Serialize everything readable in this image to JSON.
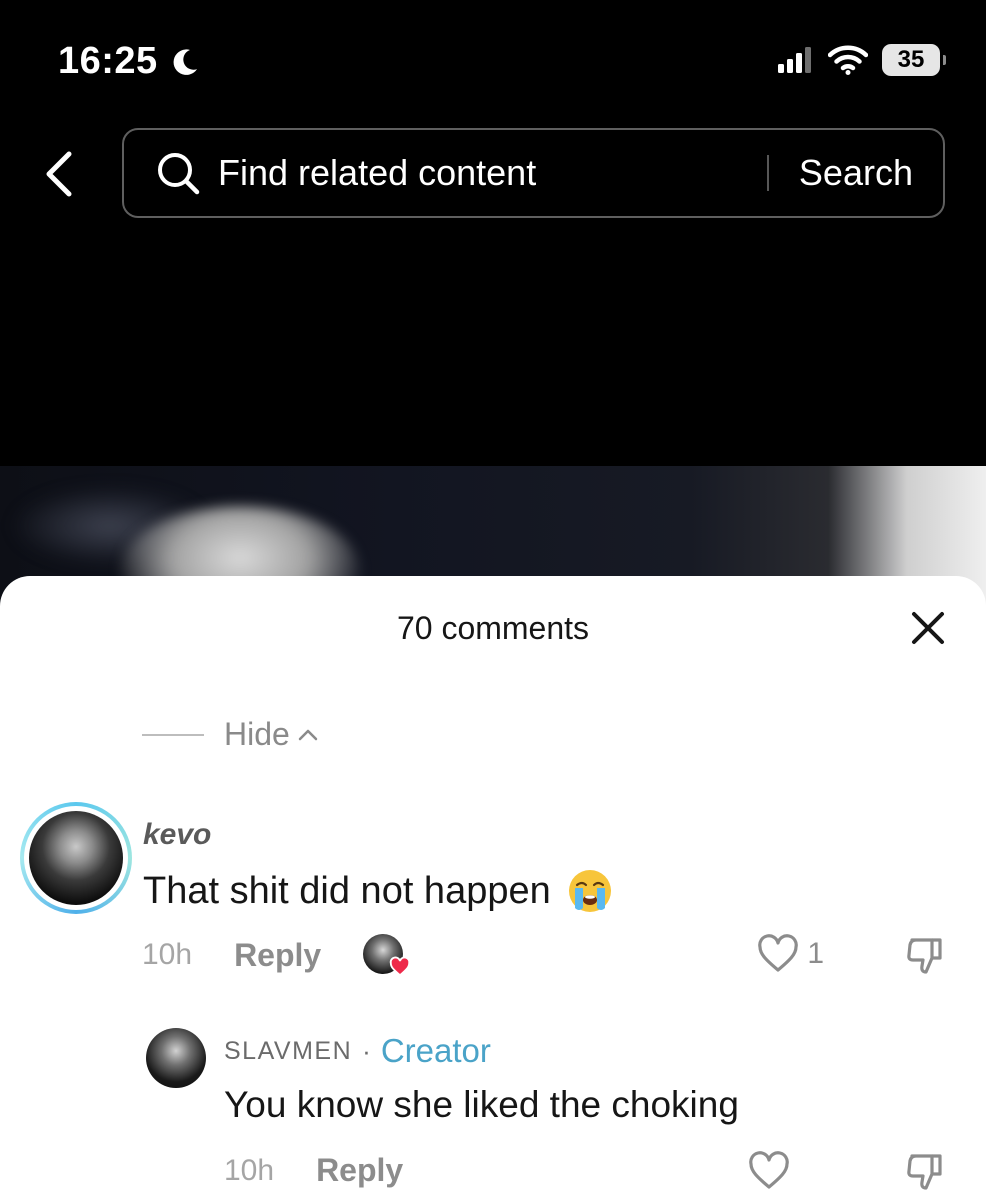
{
  "status_bar": {
    "time": "16:25",
    "battery": "35",
    "icons": [
      "moon-icon",
      "signal-icon",
      "wifi-icon",
      "battery-icon"
    ]
  },
  "search_bar": {
    "placeholder": "Find related content",
    "button_label": "Search"
  },
  "comments": {
    "title": "70 comments",
    "hide_label": "Hide",
    "items": [
      {
        "username": "kevo",
        "text": "That shit did not happen",
        "emoji": "loudly-crying-face",
        "time": "10h",
        "reply_label": "Reply",
        "likes": "1",
        "liked_by_creator": true,
        "replies": [
          {
            "username": "SLAVMEN",
            "badge": "Creator",
            "text": "You know she liked the choking",
            "time": "10h",
            "reply_label": "Reply"
          }
        ]
      }
    ]
  },
  "colors": {
    "accent_creator": "#4aa3c8",
    "heart_red": "#ee2a4a",
    "ring": "#5bc8ee"
  }
}
